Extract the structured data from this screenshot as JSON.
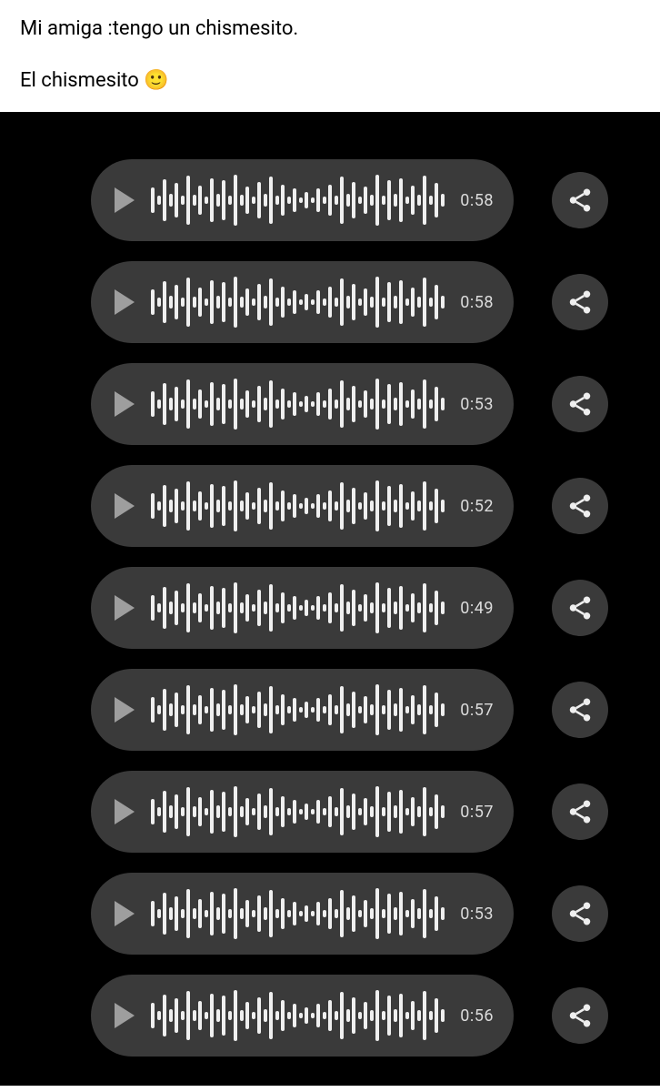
{
  "caption": {
    "line1": "Mi amiga :tengo un chismesito.",
    "line2_prefix": "El chismesito ",
    "emoji": "🙂"
  },
  "audio_messages": [
    {
      "duration": "0:58"
    },
    {
      "duration": "0:58"
    },
    {
      "duration": "0:53"
    },
    {
      "duration": "0:52"
    },
    {
      "duration": "0:49"
    },
    {
      "duration": "0:57"
    },
    {
      "duration": "0:57"
    },
    {
      "duration": "0:53"
    },
    {
      "duration": "0:56"
    }
  ],
  "waveform_heights": [
    28,
    10,
    46,
    14,
    38,
    10,
    54,
    12,
    32,
    8,
    48,
    14,
    44,
    10,
    56,
    12,
    30,
    8,
    40,
    14,
    52,
    10,
    34,
    8,
    26,
    6,
    18,
    6,
    26,
    8,
    34,
    10,
    52,
    14,
    40,
    8,
    30,
    12,
    56,
    10,
    44,
    14,
    48,
    8,
    32,
    12,
    54,
    10,
    38,
    14
  ]
}
